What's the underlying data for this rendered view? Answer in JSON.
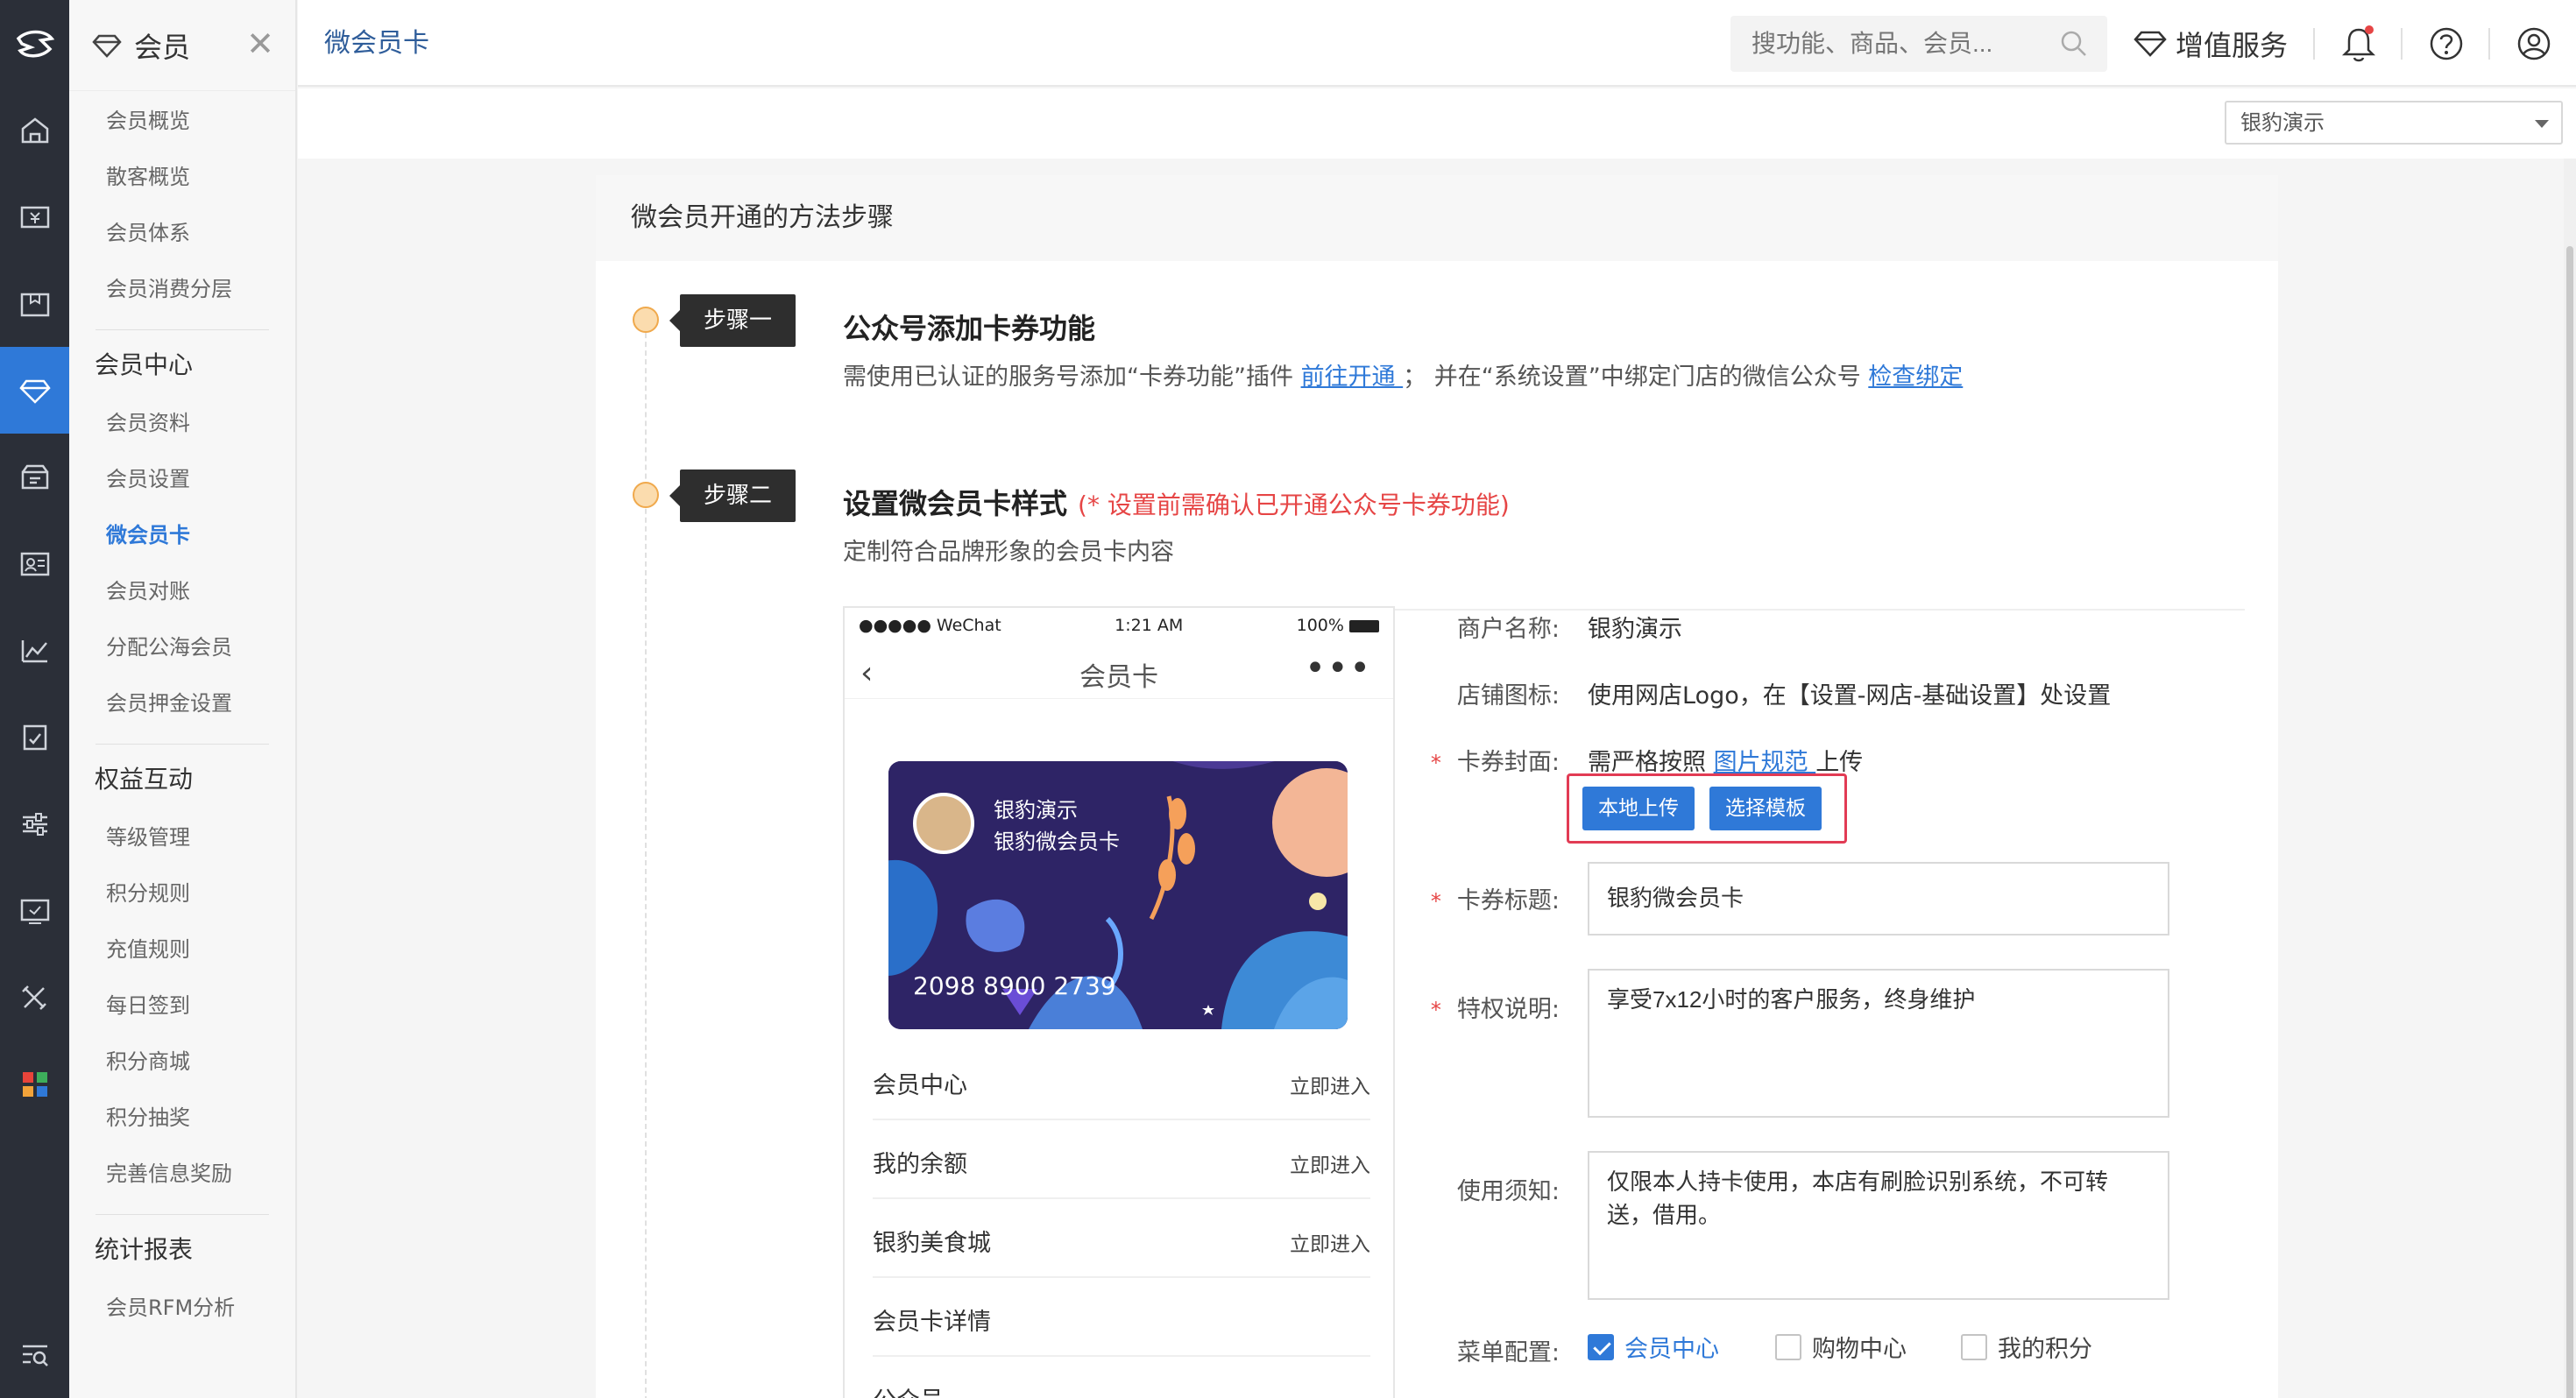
{
  "sidebar": {
    "title": "会员",
    "items_top": [
      "会员概览",
      "散客概览",
      "会员体系",
      "会员消费分层"
    ],
    "group1": "会员中心",
    "items_center": [
      "会员资料",
      "会员设置",
      "微会员卡",
      "会员对账",
      "分配公海会员",
      "会员押金设置"
    ],
    "group2": "权益互动",
    "items_rights": [
      "等级管理",
      "积分规则",
      "充值规则",
      "每日签到",
      "积分商城",
      "积分抽奖",
      "完善信息奖励"
    ],
    "group3": "统计报表",
    "items_stats": [
      "会员RFM分析"
    ]
  },
  "topbar": {
    "page_title": "微会员卡",
    "search_placeholder": "搜功能、商品、会员...",
    "value_service": "增值服务"
  },
  "store_select": "银豹演示",
  "panel": {
    "title": "微会员开通的方法步骤",
    "step1": {
      "tag": "步骤一",
      "title": "公众号添加卡券功能",
      "desc_a": "需使用已认证的服务号添加“卡券功能”插件 ",
      "link_a": "前往开通 ",
      "desc_b": "；  并在“系统设置”中绑定门店的微信公众号 ",
      "link_b": "检查绑定"
    },
    "step2": {
      "tag": "步骤二",
      "title": "设置微会员卡样式",
      "warn": "(* 设置前需确认已开通公众号卡券功能)",
      "desc": "定制符合品牌形象的会员卡内容"
    }
  },
  "phone": {
    "carrier": "●●●●● WeChat",
    "time": "1:21 AM",
    "battery": "100%",
    "title": "会员卡",
    "card_name": "银豹演示",
    "card_type": "银豹微会员卡",
    "card_no": "2098 8900 2739",
    "rows": [
      {
        "label": "会员中心",
        "action": "立即进入"
      },
      {
        "label": "我的余额",
        "action": "立即进入"
      },
      {
        "label": "银豹美食城",
        "action": "立即进入"
      },
      {
        "label": "会员卡详情",
        "action": ""
      },
      {
        "label": "公众号",
        "action": ""
      }
    ]
  },
  "form": {
    "merchant_label": "商户名称:",
    "merchant_value": "银豹演示",
    "logo_label": "店铺图标:",
    "logo_value": "使用网店Logo，在【设置-网店-基础设置】处设置",
    "cover_label": "卡券封面:",
    "cover_text_a": "需严格按照 ",
    "cover_link": "图片规范 ",
    "cover_text_b": "上传",
    "upload_local": "本地上传",
    "choose_template": "选择模板",
    "title_label": "卡券标题:",
    "title_value": "银豹微会员卡",
    "privilege_label": "特权说明:",
    "privilege_value": "享受7x12小时的客户服务，终身维护",
    "notice_label": "使用须知:",
    "notice_value": "仅限本人持卡使用，本店有刷脸识别系统，不可转送，借用。",
    "menu_label": "菜单配置:",
    "menu_options": [
      {
        "label": "会员中心",
        "checked": true
      },
      {
        "label": "购物中心",
        "checked": false
      },
      {
        "label": "我的积分",
        "checked": false
      }
    ]
  },
  "colors": {
    "accent": "#2f79d8",
    "rail": "#2b2f38",
    "warn": "#e64545"
  }
}
